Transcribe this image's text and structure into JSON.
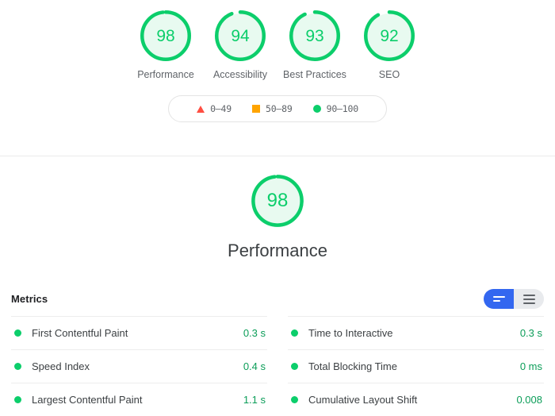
{
  "summary": {
    "gauges": [
      {
        "score": "98",
        "label": "Performance",
        "pct": 98,
        "color": "#0cce6b",
        "icon": "gauge-circle"
      },
      {
        "score": "94",
        "label": "Accessibility",
        "pct": 94,
        "color": "#0cce6b",
        "icon": "gauge-circle"
      },
      {
        "score": "93",
        "label": "Best Practices",
        "pct": 93,
        "color": "#0cce6b",
        "icon": "gauge-circle"
      },
      {
        "score": "92",
        "label": "SEO",
        "pct": 92,
        "color": "#0cce6b",
        "icon": "gauge-circle"
      }
    ],
    "legend": [
      {
        "icon": "triangle-icon",
        "shape": "triangle",
        "color": "#ff4e42",
        "range": "0–49"
      },
      {
        "icon": "square-icon",
        "shape": "square",
        "color": "#ffa400",
        "range": "50–89"
      },
      {
        "icon": "circle-icon",
        "shape": "circle",
        "color": "#0cce6b",
        "range": "90–100"
      }
    ]
  },
  "category": {
    "score": "98",
    "pct": 98,
    "title": "Performance",
    "color": "#0cce6b"
  },
  "metrics": {
    "title": "Metrics",
    "toggle": {
      "active_option": "condensed-view",
      "options": [
        {
          "name": "condensed-view",
          "icon": "two-bar-icon",
          "selected": true,
          "bg": "#3367f0"
        },
        {
          "name": "expanded-view",
          "icon": "three-bar-icon",
          "selected": false,
          "bg": "#e8eaed"
        }
      ]
    },
    "columns": [
      [
        {
          "name": "First Contentful Paint",
          "value": "0.3 s",
          "status": "pass",
          "color": "#0cce6b"
        },
        {
          "name": "Speed Index",
          "value": "0.4 s",
          "status": "pass",
          "color": "#0cce6b"
        },
        {
          "name": "Largest Contentful Paint",
          "value": "1.1 s",
          "status": "pass",
          "color": "#0cce6b"
        }
      ],
      [
        {
          "name": "Time to Interactive",
          "value": "0.3 s",
          "status": "pass",
          "color": "#0cce6b"
        },
        {
          "name": "Total Blocking Time",
          "value": "0 ms",
          "status": "pass",
          "color": "#0cce6b"
        },
        {
          "name": "Cumulative Layout Shift",
          "value": "0.008",
          "status": "pass",
          "color": "#0cce6b"
        }
      ]
    ]
  }
}
